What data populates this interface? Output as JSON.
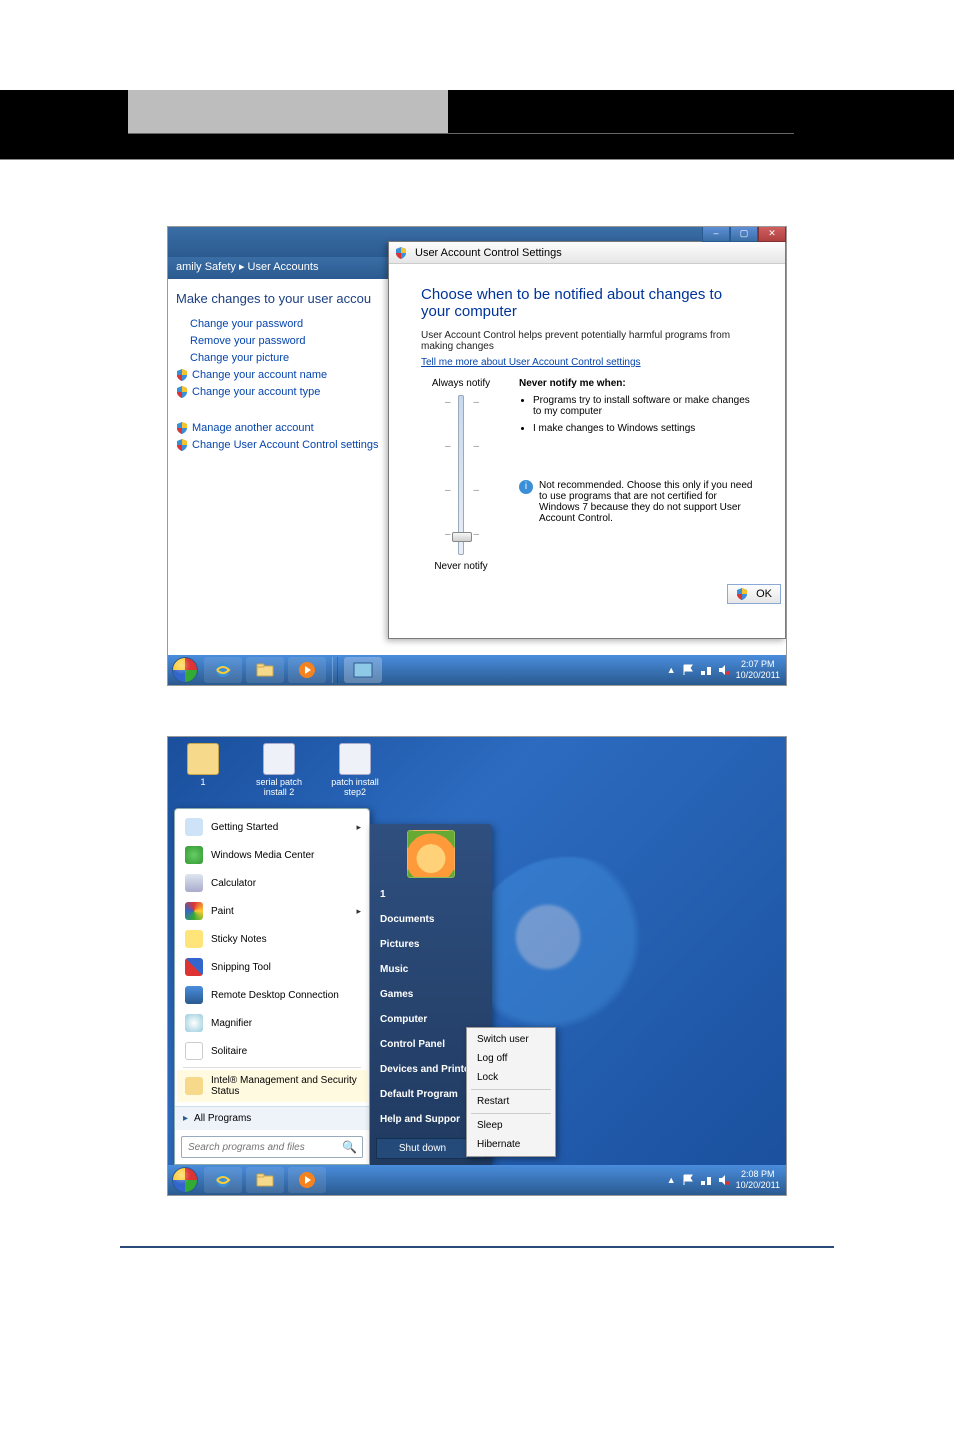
{
  "shot1": {
    "breadcrumb": "amily Safety  ▸  User Accounts",
    "heading": "Make changes to your user accou",
    "links": {
      "pwd": "Change your password",
      "rmpwd": "Remove your password",
      "pic": "Change your picture",
      "name": "Change your account name",
      "type": "Change your account type",
      "another": "Manage another account",
      "uac": "Change User Account Control settings"
    },
    "uac": {
      "title": "User Account Control Settings",
      "h1": "Choose when to be notified about changes to your computer",
      "desc": "User Account Control helps prevent potentially harmful programs from making changes",
      "more": "Tell me more about User Account Control settings",
      "always": "Always notify",
      "never": "Never notify",
      "info_h": "Never notify me when:",
      "b1": "Programs try to install software or make changes to my computer",
      "b2": "I make changes to Windows settings",
      "note": "Not recommended. Choose this only if you need to use programs that are not certified for Windows 7 because they do not support User Account Control.",
      "ok": "OK"
    },
    "tray": {
      "time": "2:07 PM",
      "date": "10/20/2011"
    }
  },
  "shot2": {
    "desktop": {
      "i1": "1",
      "i2": "serial patch install 2",
      "i3": "patch install step2"
    },
    "sm": {
      "gs": "Getting Started",
      "wmc": "Windows Media Center",
      "calc": "Calculator",
      "paint": "Paint",
      "sticky": "Sticky Notes",
      "snip": "Snipping Tool",
      "rdc": "Remote Desktop Connection",
      "mag": "Magnifier",
      "sol": "Solitaire",
      "intel": "Intel® Management and Security Status",
      "all": "All Programs",
      "search_ph": "Search programs and files"
    },
    "sr": {
      "user": "1",
      "docs": "Documents",
      "pics": "Pictures",
      "music": "Music",
      "games": "Games",
      "comp": "Computer",
      "cpl": "Control Panel",
      "dev": "Devices and Printers",
      "defprog": "Default Program",
      "help": "Help and Suppor",
      "shut": "Shut down"
    },
    "shutmenu": {
      "switch": "Switch user",
      "logoff": "Log off",
      "lock": "Lock",
      "restart": "Restart",
      "sleep": "Sleep",
      "hib": "Hibernate"
    },
    "tray": {
      "time": "2:08 PM",
      "date": "10/20/2011"
    }
  }
}
